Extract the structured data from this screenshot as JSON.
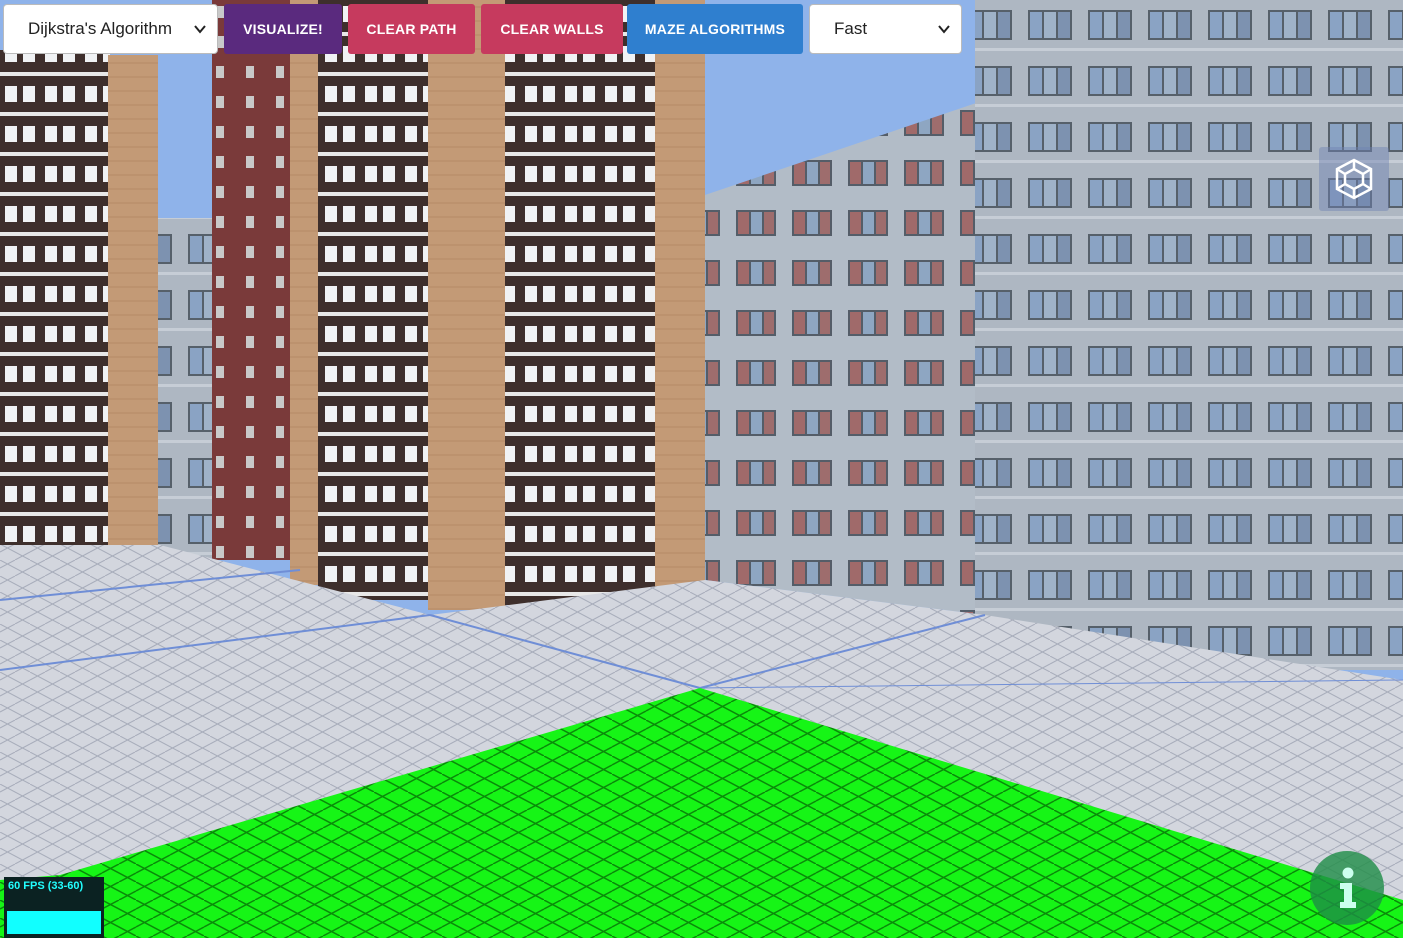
{
  "toolbar": {
    "algorithm_select": {
      "value": "Dijkstra's Algorithm"
    },
    "visualize_label": "VISUALIZE!",
    "clear_path_label": "CLEAR PATH",
    "clear_walls_label": "CLEAR WALLS",
    "maze_label": "MAZE ALGORITHMS",
    "speed_select": {
      "value": "Fast"
    }
  },
  "colors": {
    "visualize": "#5a2a7e",
    "clear_path": "#c63a5e",
    "clear_walls": "#c63a5e",
    "maze": "#2f7fcf",
    "start_tile": "#16f516",
    "sky": "#8fb3ea",
    "floor": "#c9ccd6"
  },
  "icons": {
    "view_toggle": "cube-wireframe-icon",
    "info": "info-icon"
  },
  "stats": {
    "fps_text": "60 FPS (33-60)"
  }
}
